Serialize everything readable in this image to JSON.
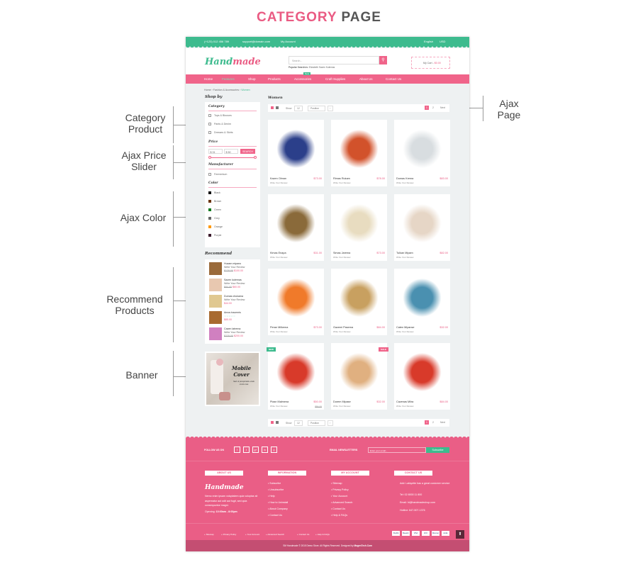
{
  "title": {
    "part1": "CATEGORY",
    "part2": "PAGE"
  },
  "annotations": {
    "category": "Category Product",
    "price": "Ajax Price Slider",
    "color": "Ajax Color",
    "recommend": "Recommend Products",
    "banner": "Banner",
    "page": "Ajax Page",
    "accent": "#e4002b"
  },
  "topbar": {
    "phone": "(+123) 012 456 789",
    "email": "support@domain.com",
    "account": "My Account",
    "language": "English",
    "currency": "USD",
    "color": "#3dbb8e"
  },
  "header": {
    "logo": "Handmade",
    "search_placeholder": "Search...",
    "popular_label": "Popular Searches:",
    "popular": [
      "Elizabeth",
      "Sazen Kulemas"
    ],
    "cart": "My Cart -",
    "cart_total": "$0.00"
  },
  "nav": {
    "items": [
      "Home",
      "Features",
      "Shop",
      "Products",
      "Accessories",
      "Craft Supplies",
      "About Us",
      "Contact Us"
    ],
    "active": "Features",
    "badge": "New",
    "color": "#f0648a"
  },
  "breadcrumb": [
    "Home",
    "Fashion & Accessories",
    "Women"
  ],
  "sidebar": {
    "title": "Shop by",
    "category_title": "Category",
    "categories": [
      "Tops & Blouses",
      "Pants & Denim",
      "Dresses & Skirts"
    ],
    "price_title": "Price",
    "price_min": "$ 31",
    "price_max": "$ 50",
    "price_button": "SEARCH",
    "manufacturer_title": "Manufacturer",
    "manufacturers": [
      "Fermentum"
    ],
    "color_title": "Color",
    "colors": [
      {
        "name": "Black",
        "hex": "#111111"
      },
      {
        "name": "Brown",
        "hex": "#6b3410"
      },
      {
        "name": "Green",
        "hex": "#0a7a1e"
      },
      {
        "name": "Grey",
        "hex": "#666666"
      },
      {
        "name": "Orange",
        "hex": "#ff9900"
      },
      {
        "name": "Purple",
        "hex": "#3a1a2c"
      }
    ]
  },
  "recommend": {
    "title": "Recommend",
    "items": [
      {
        "name": "Huzam mipano",
        "review": "Write Your Review",
        "old": "$120.00",
        "price": "$100.00"
      },
      {
        "name": "Sazen kutemas",
        "review": "Write Your Review",
        "old": "$84.00",
        "price": "$60.00"
      },
      {
        "name": "Dumas chukama",
        "review": "Write Your Review",
        "old": "",
        "price": "$44.00"
      },
      {
        "name": "Amos tracemis",
        "review": "☆☆☆☆☆",
        "old": "",
        "price": "$85.00"
      },
      {
        "name": "Cazen latrema",
        "review": "Write Your Review",
        "old": "$225.00",
        "price": "$200.00"
      }
    ]
  },
  "banner": {
    "title1": "Mobile",
    "title2": "Cover",
    "subtitle": "Sed ut perspiciatis unde omnis iste"
  },
  "main": {
    "title": "Women",
    "show_label": "Show",
    "show_value": "12",
    "sort_value": "Position",
    "pages": [
      "1",
      "2"
    ],
    "next": "Next"
  },
  "products": [
    {
      "name": "Kazen Olman",
      "price": "$73.00",
      "old": "",
      "review": "Write Your Review",
      "color": "#2b3f8a"
    },
    {
      "name": "Rimas Rukam",
      "price": "$78.00",
      "old": "",
      "review": "Write Your Review",
      "color": "#d2522b"
    },
    {
      "name": "Dumas Krema",
      "price": "$83.00",
      "old": "",
      "review": "Write Your Review",
      "color": "#d8dde0"
    },
    {
      "name": "Kimas Enapa",
      "price": "$31.00",
      "old": "",
      "review": "Write Your Review",
      "color": "#8a6a3a"
    },
    {
      "name": "Simas Jarema",
      "price": "$73.00",
      "old": "",
      "review": "Write Your Review",
      "color": "#e8dcc0"
    },
    {
      "name": "Tulkan Mipam",
      "price": "$82.00",
      "old": "",
      "review": "Write Your Review",
      "color": "#e6d6c6"
    },
    {
      "name": "Peran Milkema",
      "price": "$73.00",
      "old": "",
      "review": "Write Your Review",
      "color": "#f07a2a"
    },
    {
      "name": "Gazemi Pasema",
      "price": "$84.00",
      "old": "",
      "review": "Write Your Review",
      "color": "#c8a060"
    },
    {
      "name": "Caten Mipanse",
      "price": "$32.00",
      "old": "",
      "review": "Write Your Review",
      "color": "#4a90b0"
    },
    {
      "name": "Pizan Malmena",
      "price": "$50.00",
      "old": "$84.00",
      "review": "Write Your Review",
      "color": "#d83a2a",
      "badge": "NEW"
    },
    {
      "name": "Durem Mipase",
      "price": "$32.00",
      "old": "",
      "review": "Write Your Review",
      "color": "#e0b080",
      "badge": "SALE"
    },
    {
      "name": "Cazenas Milra",
      "price": "$84.00",
      "old": "",
      "review": "Write Your Review",
      "color": "#d83a2a"
    }
  ],
  "footer": {
    "follow": "FOLLOW US ON",
    "social": [
      "facebook",
      "twitter",
      "google-plus",
      "linkedin",
      "pinterest"
    ],
    "newsletter": "EMAIL NEWSLETTERS",
    "newsletter_placeholder": "Enter your email...",
    "subscribe": "Subscribe",
    "about_title": "ABOUT US",
    "about_logo": "Handmade",
    "about_text": "Nemo enim ipsam voluptatem quia voluptas sit aspernatur aut odit aut fugit, sed quia consequuntur magni.",
    "opening_label": "Opening:",
    "opening": "10:00am - 8:00pm",
    "info_title": "INFORMATION",
    "info": [
      "Subscribe",
      "Unsubscribe",
      "Help",
      "How to Uninstall",
      "About Company",
      "Contact Us"
    ],
    "account_title": "MY ACCOUNT",
    "account": [
      "Sitemap",
      "Privacy Policy",
      "Your Account",
      "Advanced Search",
      "Contact Us",
      "Help & FAQs"
    ],
    "contact_title": "CONTACT US",
    "address": "Add: Lafayette has a great customer service",
    "tel": "Tel: 02 8000 11 800",
    "email": "Email: hi@handmadeshop.com",
    "hotline": "Hotline: 647-507-1376",
    "bottom_links": [
      "Sitemap",
      "Privacy Policy",
      "Your Account",
      "Advanced Search",
      "Contact Us",
      "Help & FAQs"
    ],
    "payments": [
      "PayPal",
      "Maestro",
      "VISA",
      "2CO",
      "Discover",
      "AmEx"
    ],
    "copyright": "SM Handmade © 2015 Demo Store. All Rights Reserved. Designed by",
    "designer": "MagenTech.Com",
    "color": "#ea5e86"
  }
}
